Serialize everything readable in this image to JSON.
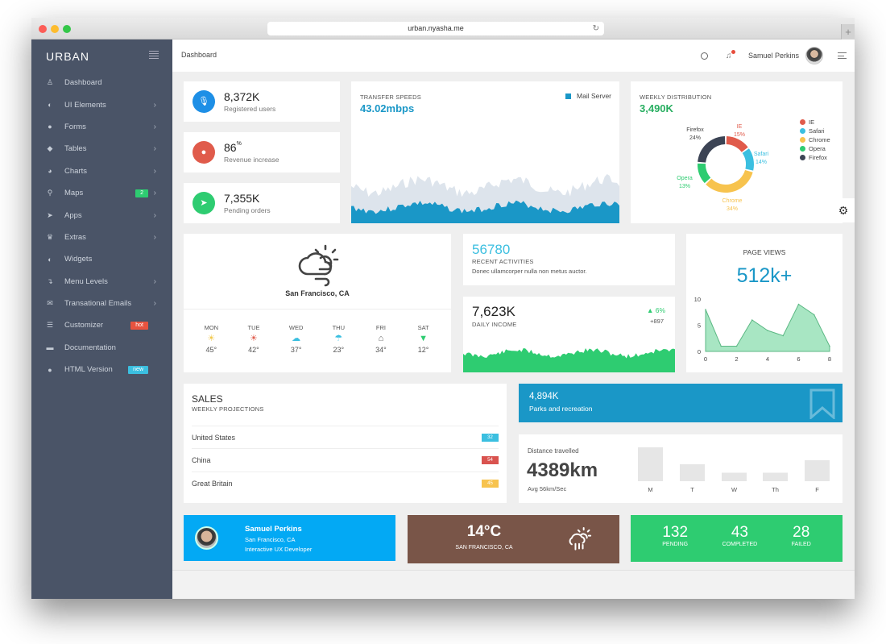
{
  "browser": {
    "url": "urban.nyasha.me",
    "reload_icon": "↻",
    "new_tab_icon": "+"
  },
  "sidebar": {
    "brand": "URBAN",
    "items": [
      {
        "label": "Dashboard",
        "icon": "♙",
        "icon_name": "dashboard-icon",
        "chevron": false
      },
      {
        "label": "UI Elements",
        "icon": "◐",
        "icon_name": "toggle-icon",
        "chevron": true
      },
      {
        "label": "Forms",
        "icon": "●",
        "icon_name": "drop-icon",
        "chevron": true
      },
      {
        "label": "Tables",
        "icon": "◆",
        "icon_name": "tag-icon",
        "chevron": true
      },
      {
        "label": "Charts",
        "icon": "◕",
        "icon_name": "pie-chart-icon",
        "chevron": true
      },
      {
        "label": "Maps",
        "icon": "⚲",
        "icon_name": "map-pin-icon",
        "chevron": true,
        "badge": "2",
        "badge_color": "#2ecc71"
      },
      {
        "label": "Apps",
        "icon": "➤",
        "icon_name": "send-icon",
        "chevron": true
      },
      {
        "label": "Extras",
        "icon": "♛",
        "icon_name": "trophy-icon",
        "chevron": true
      },
      {
        "label": "Widgets",
        "icon": "◐",
        "icon_name": "toggle-icon",
        "chevron": false
      },
      {
        "label": "Menu Levels",
        "icon": "↴",
        "icon_name": "level-down-icon",
        "chevron": true
      },
      {
        "label": "Transational Emails",
        "icon": "✉",
        "icon_name": "envelope-icon",
        "chevron": true
      },
      {
        "label": "Customizer",
        "icon": "☰",
        "icon_name": "sliders-icon",
        "chevron": false,
        "badge": "hot",
        "badge_color": "#e8533f"
      },
      {
        "label": "Documentation",
        "icon": "▬",
        "icon_name": "folder-icon",
        "chevron": false
      },
      {
        "label": "HTML Version",
        "icon": "●",
        "icon_name": "circle-icon",
        "chevron": false,
        "badge": "new",
        "badge_color": "#3bbfe0"
      }
    ],
    "chevron_glyph": "›"
  },
  "topbar": {
    "breadcrumb": "Dashboard",
    "user_name": "Samuel Perkins",
    "bell_icon": "🔔"
  },
  "stats": [
    {
      "value": "8,372K",
      "sup": "",
      "label": "Registered users",
      "icon": "🎙",
      "color": "#1e8fe6"
    },
    {
      "value": "86",
      "sup": "%",
      "label": "Revenue increase",
      "icon": "💧",
      "color": "#e05b4b"
    },
    {
      "value": "7,355K",
      "sup": "",
      "label": "Pending orders",
      "icon": "➤",
      "color": "#2ecc71"
    }
  ],
  "transfer": {
    "title": "TRANSFER SPEEDS",
    "value": "43.02mbps",
    "legend": "Mail Server",
    "legend_color": "#1a97c7"
  },
  "weekly": {
    "title": "WEEKLY DISTRIBUTION",
    "value": "3,490K"
  },
  "chart_data": [
    {
      "type": "pie",
      "title": "WEEKLY DISTRIBUTION",
      "categories": [
        "IE",
        "Safari",
        "Chrome",
        "Opera",
        "Firefox"
      ],
      "values": [
        15,
        14,
        34,
        13,
        24
      ],
      "colors": [
        "#e05b4b",
        "#3bbfe0",
        "#f7c34e",
        "#2ecc71",
        "#3c4455"
      ],
      "labels": [
        "15%",
        "14%",
        "34%",
        "13%",
        "24%"
      ],
      "legend": "right"
    },
    {
      "type": "area",
      "title": "PAGE VIEWS",
      "x": [
        0,
        1,
        2,
        3,
        4,
        5,
        6,
        7,
        8
      ],
      "values": [
        8,
        1,
        1,
        6,
        4,
        3,
        9,
        7,
        1
      ],
      "xticks": [
        "0",
        "2",
        "4",
        "6",
        "8"
      ],
      "yticks": [
        "0",
        "5",
        "10"
      ],
      "xlim": [
        0,
        8
      ],
      "ylim": [
        0,
        10
      ]
    },
    {
      "type": "bar",
      "title": "Distance travelled",
      "categories": [
        "M",
        "T",
        "W",
        "Th",
        "F"
      ],
      "values": [
        10,
        5,
        2.5,
        2.5,
        6.2
      ],
      "ylim": [
        0,
        10
      ]
    }
  ],
  "weather": {
    "location": "San Francisco, CA",
    "days": [
      {
        "name": "MON",
        "temp": "45°",
        "icon": "☀",
        "color": "#f2c94c"
      },
      {
        "name": "TUE",
        "temp": "42°",
        "icon": "☀",
        "color": "#e05b4b"
      },
      {
        "name": "WED",
        "temp": "37°",
        "icon": "☁",
        "color": "#3bbfe0"
      },
      {
        "name": "THU",
        "temp": "23°",
        "icon": "☂",
        "color": "#3bbfe0"
      },
      {
        "name": "FRI",
        "temp": "34°",
        "icon": "⌂",
        "color": "#666"
      },
      {
        "name": "SAT",
        "temp": "12°",
        "icon": "▼",
        "color": "#2ecc71"
      }
    ]
  },
  "activities": {
    "value": "56780",
    "title": "RECENT ACTIVITIES",
    "text": "Donec ullamcorper nulla non metus auctor."
  },
  "income": {
    "value": "7,623K",
    "title": "DAILY INCOME",
    "change": "▲ 6%",
    "delta": "+897"
  },
  "pageviews": {
    "title": "PAGE VIEWS",
    "value": "512k+"
  },
  "sales": {
    "title": "SALES",
    "subtitle": "WEEKLY PROJECTIONS",
    "rows": [
      {
        "country": "United States",
        "value": "32",
        "color": "#3bbfe0"
      },
      {
        "country": "China",
        "value": "54",
        "color": "#d9534f"
      },
      {
        "country": "Great Britain",
        "value": "45",
        "color": "#f7c34e"
      }
    ]
  },
  "parks": {
    "value": "4,894K",
    "label": "Parks and recreation"
  },
  "distance": {
    "title": "Distance travelled",
    "value": "4389km",
    "avg": "Avg 56km/Sec"
  },
  "profile": {
    "name": "Samuel Perkins",
    "location": "San Francisco, CA",
    "role": "Interactive UX Developer"
  },
  "weather_card": {
    "temp": "14°C",
    "location": "SAN FRANCISCO, CA"
  },
  "tasks": [
    {
      "value": "132",
      "label": "PENDING"
    },
    {
      "value": "43",
      "label": "COMPLETED"
    },
    {
      "value": "28",
      "label": "FAILED"
    }
  ],
  "gear_icon": "⚙"
}
